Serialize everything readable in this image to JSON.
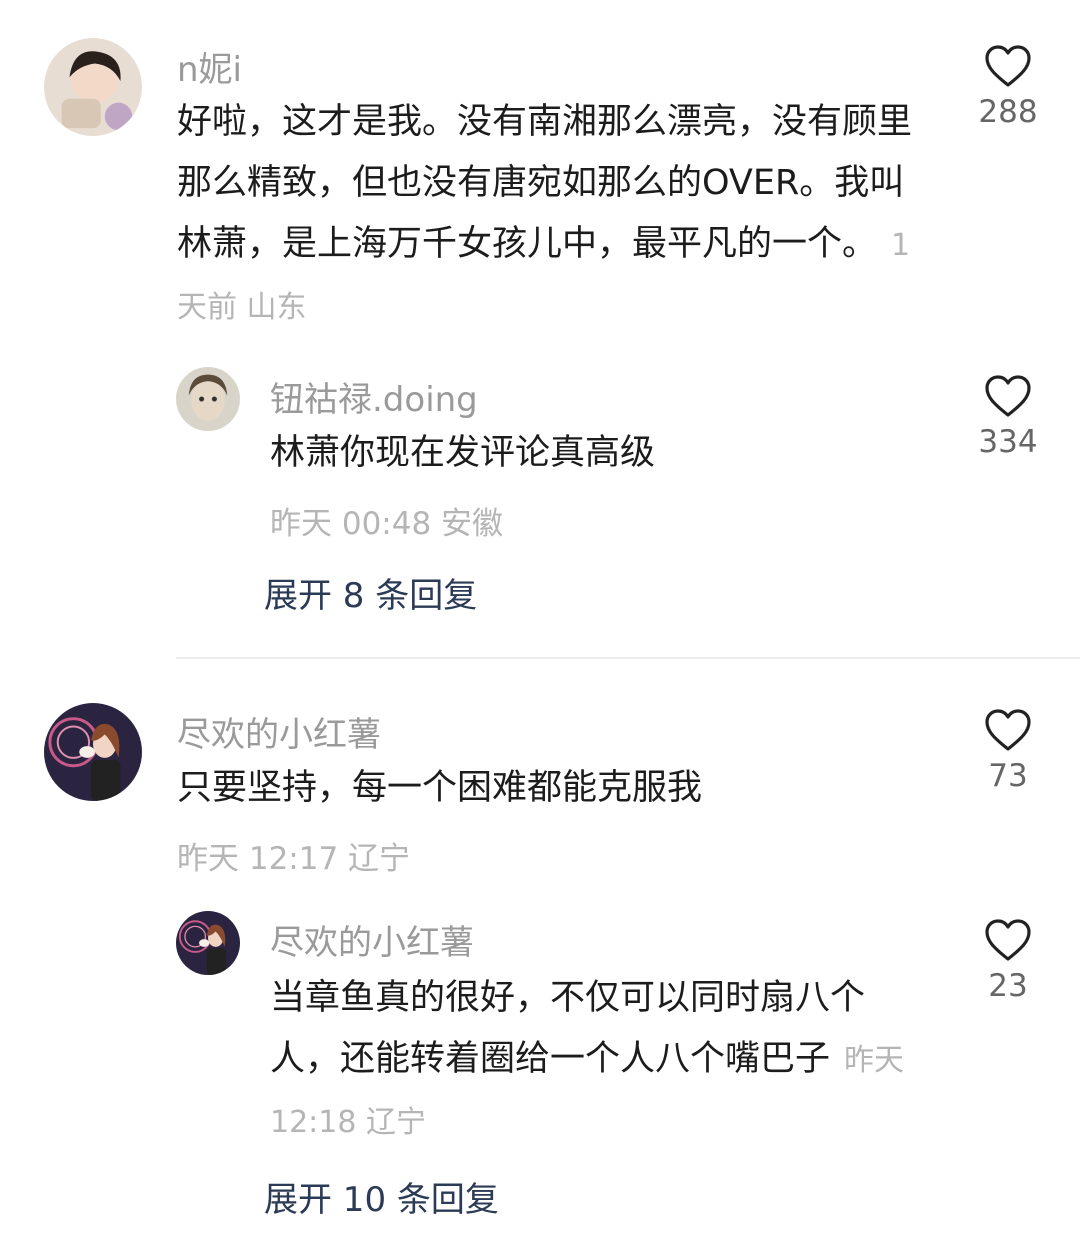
{
  "comments": [
    {
      "user": "n妮i",
      "text": "好啦，这才是我。没有南湘那么漂亮，没有顾里那么精致，但也没有唐宛如那么的OVER。我叫林萧，是上海万千女孩儿中，最平凡的一个。",
      "meta": "1天前 山东",
      "likes": "288",
      "reply": {
        "user": "钮祜禄.doing",
        "text": "林萧你现在发评论真高级",
        "meta": "昨天 00:48 安徽",
        "likes": "334"
      },
      "expand": "展开 8 条回复"
    },
    {
      "user": "尽欢的小红薯",
      "text": "只要坚持，每一个困难都能克服我",
      "meta": "昨天 12:17 辽宁",
      "likes": "73",
      "reply": {
        "user": "尽欢的小红薯",
        "text": "当章鱼真的很好，不仅可以同时扇八个人，还能转着圈给一个人八个嘴巴子",
        "meta": "昨天 12:18 辽宁",
        "likes": "23"
      },
      "expand": "展开 10 条回复"
    }
  ],
  "icons": {
    "like": "heart-outline-icon"
  }
}
